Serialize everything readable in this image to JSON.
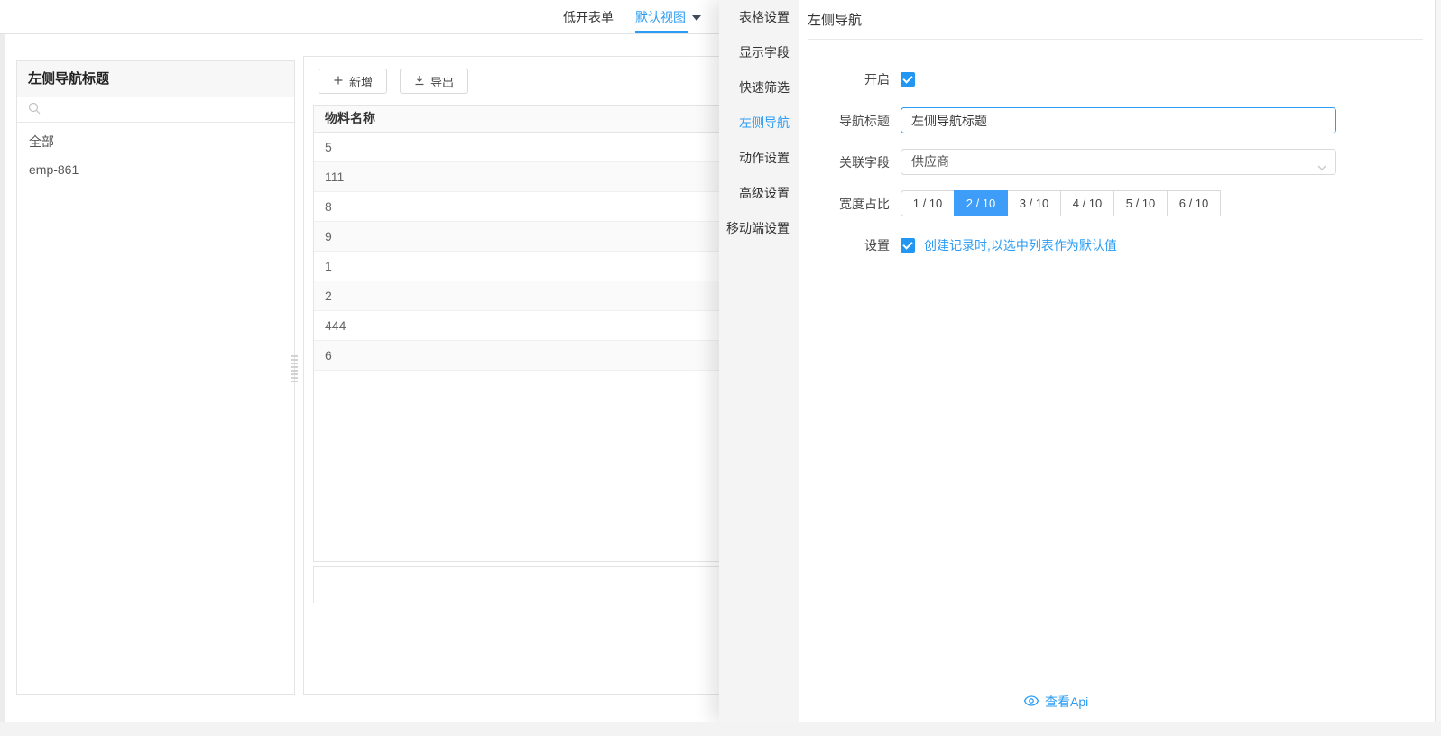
{
  "topbar": {
    "tabs": [
      {
        "label": "低开表单",
        "active": false
      },
      {
        "label": "默认视图",
        "active": true
      }
    ]
  },
  "left_panel": {
    "title": "左侧导航标题",
    "search_placeholder": "",
    "items": [
      "全部",
      "emp-861"
    ]
  },
  "content": {
    "toolbar": {
      "add_label": "新增",
      "export_label": "导出"
    },
    "table": {
      "column_header": "物料名称",
      "rows": [
        "5",
        "111",
        "8",
        "9",
        "1",
        "2",
        "444",
        "6"
      ]
    }
  },
  "drawer": {
    "menu": {
      "items": [
        "表格设置",
        "显示字段",
        "快速筛选",
        "左侧导航",
        "动作设置",
        "高级设置",
        "移动端设置"
      ],
      "active": "左侧导航"
    },
    "panel": {
      "title": "左侧导航",
      "form": {
        "enable": {
          "label": "开启",
          "checked": true
        },
        "nav_title": {
          "label": "导航标题",
          "value": "左侧导航标题"
        },
        "related_field": {
          "label": "关联字段",
          "value": "供应商"
        },
        "width_ratio": {
          "label": "宽度占比",
          "options": [
            "1 / 10",
            "2 / 10",
            "3 / 10",
            "4 / 10",
            "5 / 10",
            "6 / 10"
          ],
          "active": "2 / 10"
        },
        "settings": {
          "label": "设置",
          "checked": true,
          "option_label": "创建记录时,以选中列表作为默认值"
        }
      },
      "footer": {
        "view_api_label": "查看Api"
      }
    }
  },
  "icons": {
    "tab_caret": "caret-down",
    "search": "magnifier",
    "add": "plus",
    "export": "download",
    "select_arrow": "chevron-down",
    "view_api": "eye"
  },
  "colors": {
    "accent": "#2b9cf4",
    "active_option_bg": "#3d9df8",
    "checkbox": "#2196f3",
    "table_stripe": "#fafafa",
    "menu_bg": "#f4f4f4"
  }
}
